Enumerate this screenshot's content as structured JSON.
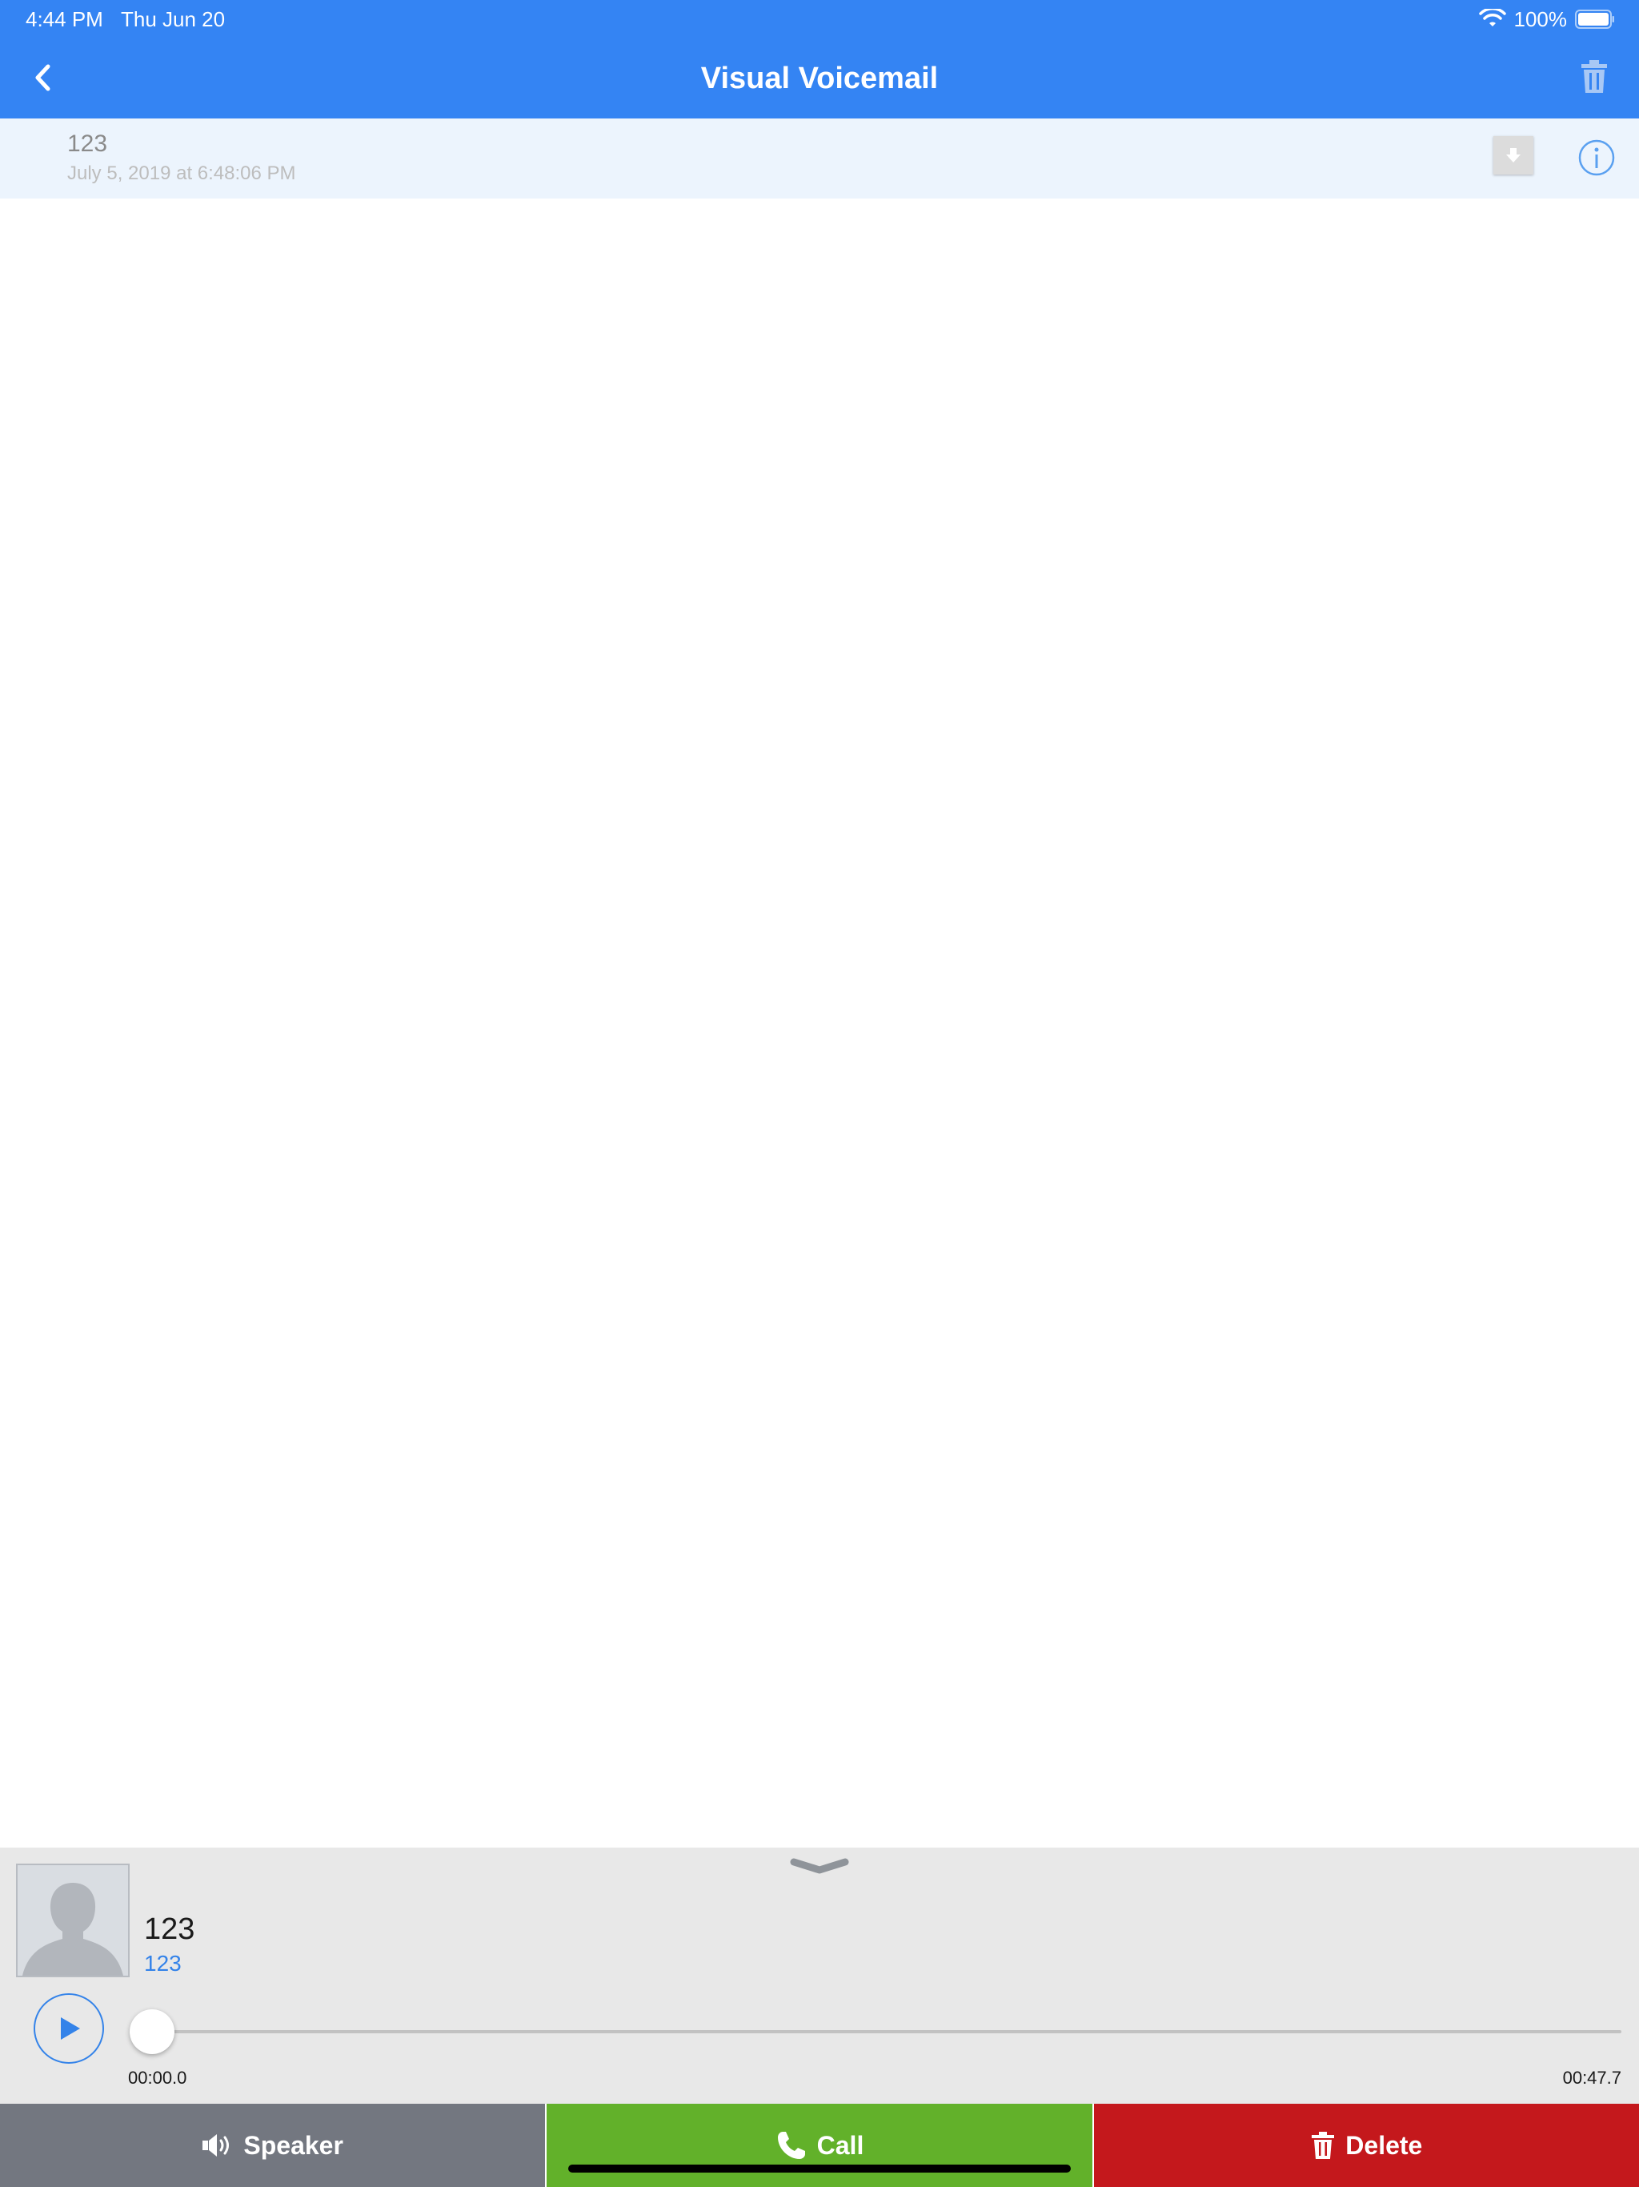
{
  "status_bar": {
    "time": "4:44 PM",
    "date": "Thu Jun 20",
    "battery": "100%",
    "icons": [
      "wifi-icon",
      "battery-icon"
    ]
  },
  "nav": {
    "title": "Visual Voicemail",
    "back_icon": "chevron-left-icon",
    "trash_icon": "trash-icon"
  },
  "voicemails": [
    {
      "number": "123",
      "date": "July 5, 2019 at 6:48:06 PM",
      "icons": [
        "download-icon",
        "info-icon"
      ]
    }
  ],
  "player": {
    "caller_name": "123",
    "caller_number": "123",
    "current_time": "00:00.0",
    "total_time": "00:47.7",
    "progress": 0,
    "icons": [
      "chevron-down-icon",
      "avatar-icon",
      "play-icon"
    ]
  },
  "actions": {
    "speaker_label": "Speaker",
    "call_label": "Call",
    "delete_label": "Delete"
  },
  "colors": {
    "header": "#3484f3",
    "row_highlight": "#ecf4fd",
    "player_bg": "#e8e8e8",
    "accent": "#3483e9",
    "speaker": "#737780",
    "call": "#62b12a",
    "delete": "#c4181c"
  }
}
